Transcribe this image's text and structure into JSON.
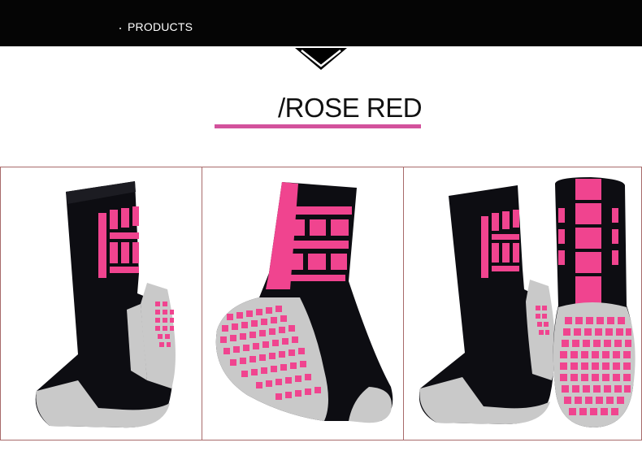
{
  "header": {
    "section_label": "PRODUCTS"
  },
  "product": {
    "color_title": "/ROSE RED"
  },
  "colors": {
    "accent": "#d3529c",
    "sock_black": "#0d0d12",
    "sock_pink": "#f0448f",
    "sock_gray": "#c9c9c9",
    "panel_border": "#a86a6a",
    "topbar": "#050505"
  },
  "images": [
    {
      "view": "side"
    },
    {
      "view": "rear-angle"
    },
    {
      "view": "side-and-back"
    }
  ]
}
